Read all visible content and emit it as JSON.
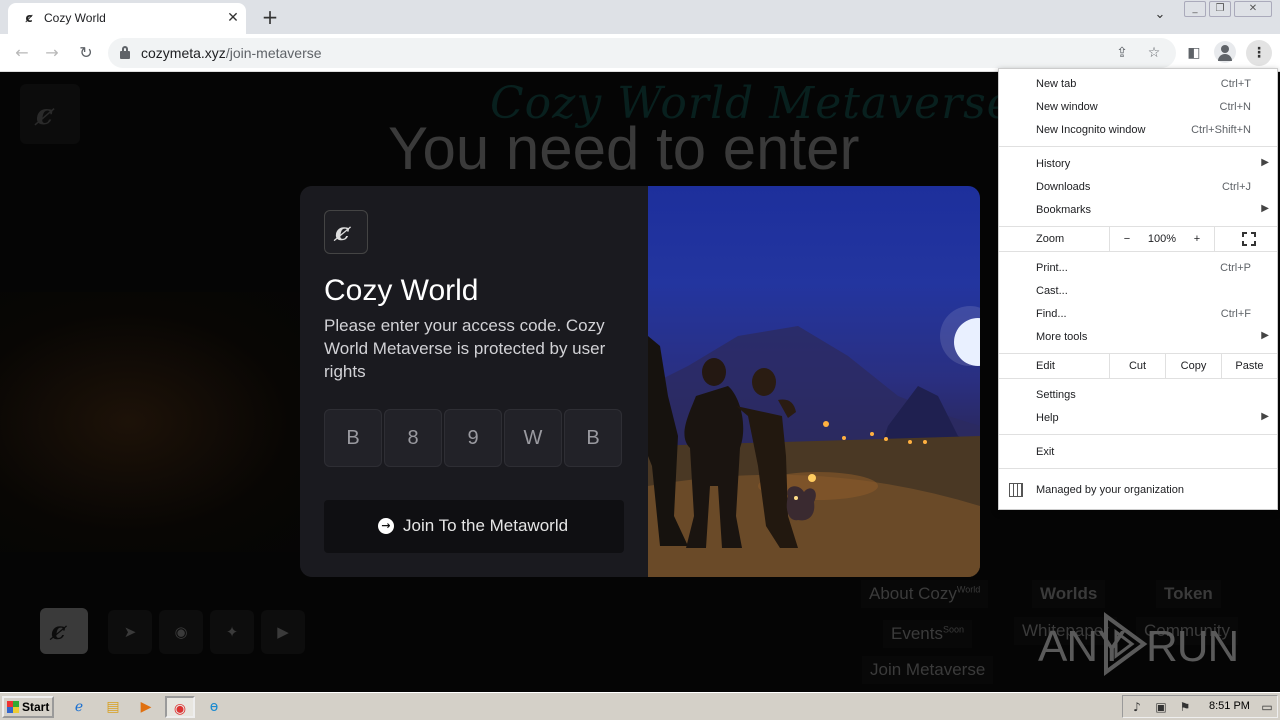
{
  "browser": {
    "tab_title": "Cozy World",
    "tab_close": "✕",
    "new_tab": "+",
    "url_host": "cozymeta.xyz",
    "url_path": "/join-metaverse"
  },
  "page": {
    "bg_brand": "Cozy World Metaverse",
    "bg_heading": "You need to enter the access",
    "footer": {
      "about": "About Cozy",
      "about_sup": "World",
      "worlds": "Worlds",
      "token": "Token",
      "events": "Events",
      "events_sup": "Soon",
      "whitepaper": "Whitepaper",
      "community": "Community",
      "join": "Join Metaverse"
    }
  },
  "modal": {
    "title": "Cozy World",
    "description": "Please enter your access code. Cozy World Metaverse is protected by user rights",
    "code": [
      "B",
      "8",
      "9",
      "W",
      "B"
    ],
    "join_button": "Join To the Metaworld"
  },
  "menu": {
    "new_tab": {
      "label": "New tab",
      "shortcut": "Ctrl+T"
    },
    "new_window": {
      "label": "New window",
      "shortcut": "Ctrl+N"
    },
    "new_incognito": {
      "label": "New Incognito window",
      "shortcut": "Ctrl+Shift+N"
    },
    "history": {
      "label": "History"
    },
    "downloads": {
      "label": "Downloads",
      "shortcut": "Ctrl+J"
    },
    "bookmarks": {
      "label": "Bookmarks"
    },
    "zoom": {
      "label": "Zoom",
      "minus": "−",
      "value": "100%",
      "plus": "+"
    },
    "print": {
      "label": "Print...",
      "shortcut": "Ctrl+P"
    },
    "cast": {
      "label": "Cast..."
    },
    "find": {
      "label": "Find...",
      "shortcut": "Ctrl+F"
    },
    "more_tools": {
      "label": "More tools"
    },
    "edit": {
      "label": "Edit",
      "cut": "Cut",
      "copy": "Copy",
      "paste": "Paste"
    },
    "settings": {
      "label": "Settings"
    },
    "help": {
      "label": "Help"
    },
    "exit": {
      "label": "Exit"
    },
    "managed": {
      "label": "Managed by your organization"
    }
  },
  "watermark": {
    "left": "ANY",
    "right": "RUN"
  },
  "taskbar": {
    "start": "Start",
    "clock": "8:51 PM"
  }
}
